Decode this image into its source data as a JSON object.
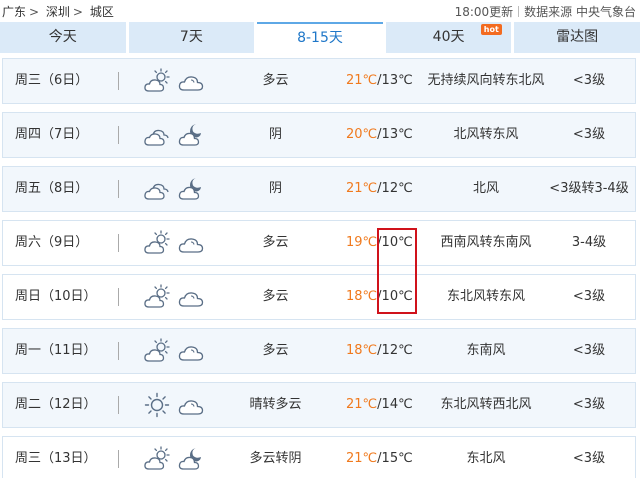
{
  "breadcrumb": {
    "province": "广东",
    "city": "深圳",
    "district": "城区",
    "sep": ">"
  },
  "header": {
    "update_time": "18:00更新",
    "source": "数据来源 中央气象台"
  },
  "tabs": [
    {
      "label": "今天"
    },
    {
      "label": "7天"
    },
    {
      "label": "8-15天",
      "active": true
    },
    {
      "label": "40天",
      "badge": "hot"
    },
    {
      "label": "雷达图"
    }
  ],
  "forecast": [
    {
      "day": "周三（6日）",
      "icon_day": "partly-cloudy-day-icon",
      "icon_night": "cloudy-icon",
      "desc": "多云",
      "high": "21℃",
      "low": "13℃",
      "wind": "无持续风向转东北风",
      "level": "<3级"
    },
    {
      "day": "周四（7日）",
      "icon_day": "overcast-icon",
      "icon_night": "partly-cloudy-night-icon",
      "desc": "阴",
      "high": "20℃",
      "low": "13℃",
      "wind": "北风转东风",
      "level": "<3级"
    },
    {
      "day": "周五（8日）",
      "icon_day": "overcast-icon",
      "icon_night": "partly-cloudy-night-icon",
      "desc": "阴",
      "high": "21℃",
      "low": "12℃",
      "wind": "北风",
      "level": "<3级转3-4级"
    },
    {
      "day": "周六（9日）",
      "icon_day": "partly-cloudy-day-icon",
      "icon_night": "cloudy-icon",
      "desc": "多云",
      "high": "19℃",
      "low": "10℃",
      "wind": "西南风转东南风",
      "level": "3-4级"
    },
    {
      "day": "周日（10日）",
      "icon_day": "partly-cloudy-day-icon",
      "icon_night": "cloudy-icon",
      "desc": "多云",
      "high": "18℃",
      "low": "10℃",
      "wind": "东北风转东风",
      "level": "<3级"
    },
    {
      "day": "周一（11日）",
      "icon_day": "partly-cloudy-day-icon",
      "icon_night": "cloudy-icon",
      "desc": "多云",
      "high": "18℃",
      "low": "12℃",
      "wind": "东南风",
      "level": "<3级"
    },
    {
      "day": "周二（12日）",
      "icon_day": "sunny-icon",
      "icon_night": "cloudy-icon",
      "desc": "晴转多云",
      "high": "21℃",
      "low": "14℃",
      "wind": "东北风转西北风",
      "level": "<3级"
    },
    {
      "day": "周三（13日）",
      "icon_day": "partly-cloudy-day-icon",
      "icon_night": "partly-cloudy-night-icon",
      "desc": "多云转阴",
      "high": "21℃",
      "low": "15℃",
      "wind": "东北风",
      "level": "<3级"
    }
  ],
  "temp_separator": "/",
  "colors": {
    "high_temp": "#f07a1e",
    "tab_active_text": "#1f77c8",
    "tab_bg": "#dbeaf8",
    "row_bg": "#f2f7fc",
    "highlight_box": "#d0121b",
    "hot_badge": "#f36b20"
  }
}
